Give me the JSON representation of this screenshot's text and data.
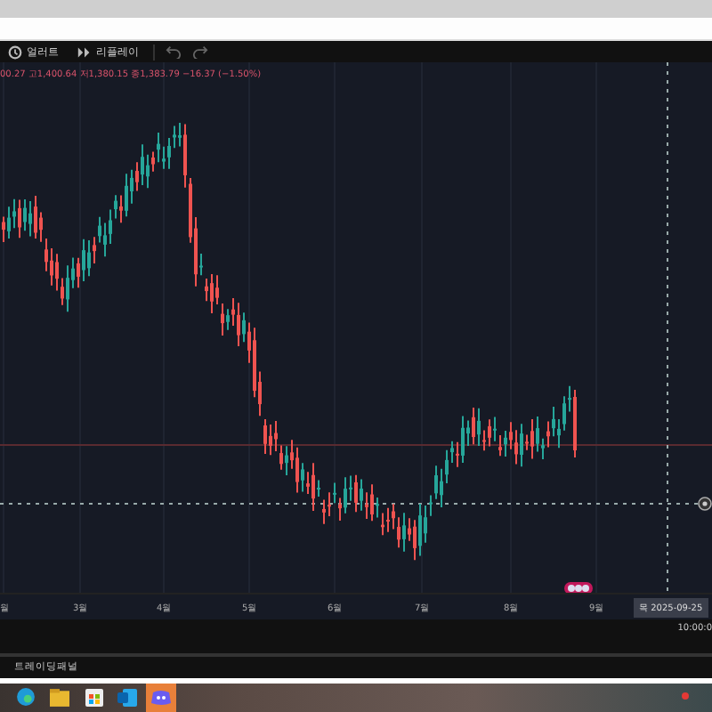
{
  "toolbar": {
    "items": [
      {
        "kind": "alert",
        "label": "얼러트"
      },
      {
        "kind": "replay",
        "label": "리플레이"
      }
    ]
  },
  "ohlc_legend": "00.27 고1,400.64 저1,380.15 종1,383.79 −16.37 (−1.50%)",
  "chart": {
    "kind": "candlestick"
  },
  "x_axis": {
    "labels": [
      "월",
      "3월",
      "4월",
      "5월",
      "6월",
      "7월",
      "8월",
      "9월"
    ],
    "cursor_date": "목 2025-09-25"
  },
  "time_readout": "10:00:0",
  "bottom_panel": {
    "tab": "트레이딩패널"
  },
  "taskbar": {
    "apps": [
      {
        "kind": "browser",
        "selected": false
      },
      {
        "kind": "folder",
        "selected": false
      },
      {
        "kind": "store",
        "selected": false
      },
      {
        "kind": "mail",
        "selected": false
      },
      {
        "kind": "chat",
        "selected": true
      }
    ]
  }
}
